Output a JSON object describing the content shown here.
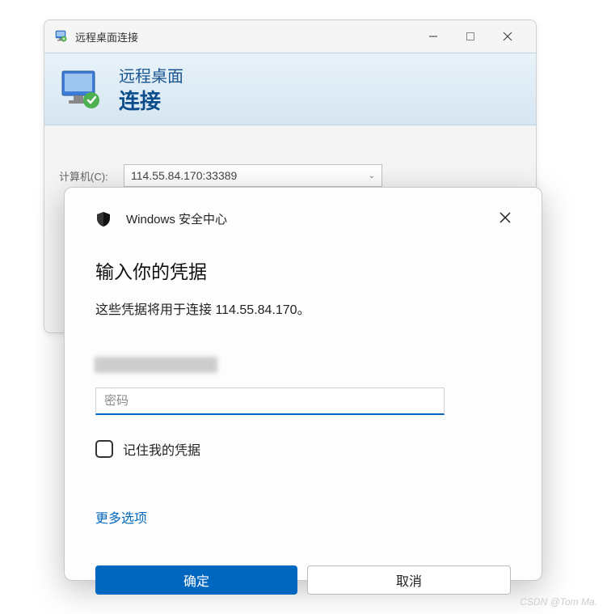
{
  "rdp": {
    "window_title": "远程桌面连接",
    "banner": {
      "line1": "远程桌面",
      "line2": "连接"
    },
    "computer_label": "计算机(C):",
    "computer_value": "114.55.84.170:33389"
  },
  "security": {
    "header": "Windows 安全中心",
    "title": "输入你的凭据",
    "subtitle": "这些凭据将用于连接 114.55.84.170。",
    "password_placeholder": "密码",
    "remember_label": "记住我的凭据",
    "more_options": "更多选项",
    "ok": "确定",
    "cancel": "取消"
  },
  "watermark": "CSDN @Tom Ma."
}
